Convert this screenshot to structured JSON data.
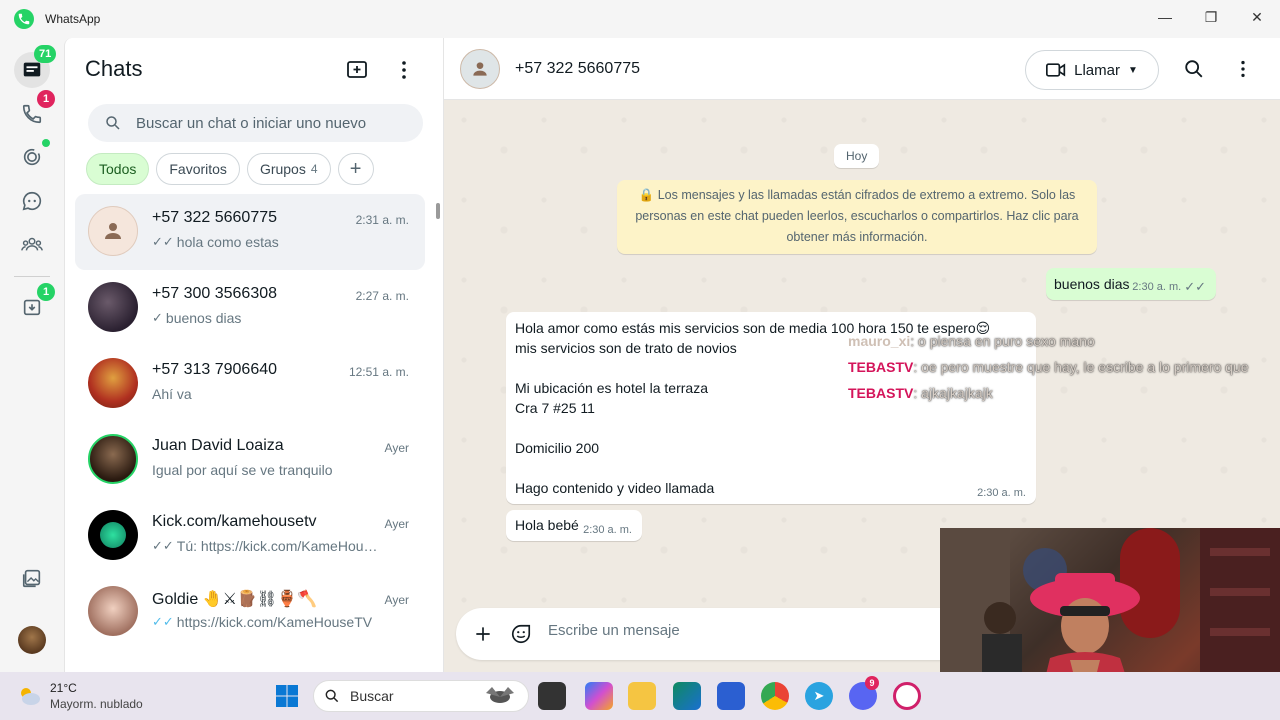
{
  "window": {
    "title": "WhatsApp"
  },
  "rail": {
    "chats_badge": "71",
    "calls_badge": "1",
    "archive_badge": "1"
  },
  "chats_panel": {
    "title": "Chats",
    "search_placeholder": "Buscar un chat o iniciar uno nuevo",
    "filters": [
      {
        "label": "Todos"
      },
      {
        "label": "Favoritos"
      },
      {
        "label": "Grupos",
        "count": "4"
      }
    ],
    "chats": [
      {
        "name": "+57 322 5660775",
        "time": "2:31 a. m.",
        "preview": "hola como estas",
        "tick": "✓✓"
      },
      {
        "name": "+57 300 3566308",
        "time": "2:27 a. m.",
        "preview": "buenos dias",
        "tick": "✓"
      },
      {
        "name": "+57 313 7906640",
        "time": "12:51 a. m.",
        "preview": "Ahí va",
        "tick": ""
      },
      {
        "name": "Juan David Loaiza",
        "time": "Ayer",
        "preview": "Igual por aquí se ve tranquilo",
        "tick": ""
      },
      {
        "name": "Kick.com/kamehousetv",
        "time": "Ayer",
        "preview": "Tú: https://kick.com/KameHou…",
        "tick": "✓✓"
      },
      {
        "name": "Goldie 🤚⚔🪵⛓🏺🪓",
        "time": "Ayer",
        "preview": "https://kick.com/KameHouseTV",
        "tick": "✓✓"
      }
    ]
  },
  "conversation": {
    "title": "+57 322 5660775",
    "call_label": "Llamar",
    "date_divider": "Hoy",
    "encryption_notice": "🔒 Los mensajes y las llamadas están cifrados de extremo a extremo. Solo las personas en este chat pueden leerlos, escucharlos o compartirlos. Haz clic para obtener más información.",
    "messages": [
      {
        "direction": "out",
        "text": "buenos dias",
        "time": "2:30 a. m.",
        "tick": "✓✓"
      },
      {
        "direction": "in",
        "text": "Hola amor como estás mis servicios son de media 100 hora 150 te espero😌\nmis servicios son de trato de novios\n\nMi ubicación es hotel la terraza\nCra 7 #25 11\n\nDomicilio 200\n\nHago contenido y video llamada",
        "time": "2:30 a. m."
      },
      {
        "direction": "in",
        "text": "Hola bebé",
        "time": "2:30 a. m."
      }
    ],
    "composer_placeholder": "Escribe un mensaje"
  },
  "stream_overlay": [
    {
      "user": "mauro_xi",
      "message": ": o piensa en puro sexo mano"
    },
    {
      "user": "TEBASTV",
      "message": ": oe pero muestre que hay, le escribe a lo primero que"
    },
    {
      "user": "TEBASTV",
      "message": ": ajkajkajkajk"
    }
  ],
  "taskbar": {
    "temperature": "21°C",
    "weather": "Mayorm. nublado",
    "search_label": "Buscar",
    "discord_badge": "9"
  },
  "colors": {
    "accent": "#25d366",
    "outgoing_bubble": "#d9fdd3",
    "chat_background": "#efeae2",
    "encryption_notice_bg": "#fdf3c8"
  }
}
